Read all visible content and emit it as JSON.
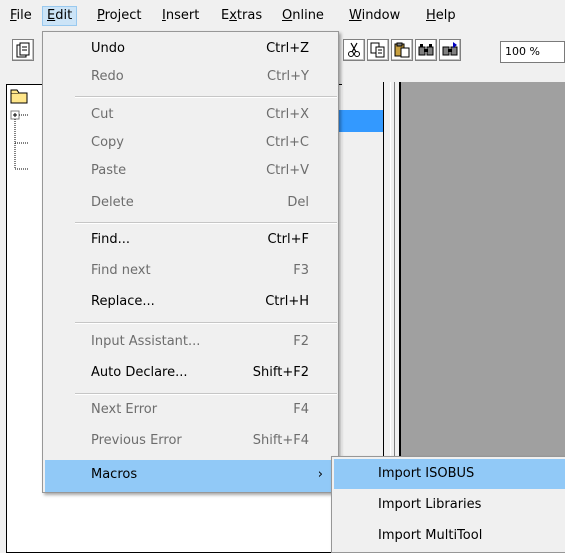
{
  "menubar": {
    "items": [
      {
        "label": "File",
        "access_key": "F",
        "rest": "ile"
      },
      {
        "label": "Edit",
        "access_key": "E",
        "rest": "dit"
      },
      {
        "label": "Project",
        "access_key": "P",
        "rest": "roject"
      },
      {
        "label": "Insert",
        "access_key": "I",
        "rest": "nsert"
      },
      {
        "label": "Extras",
        "pre": "E",
        "access_key": "x",
        "rest": "tras"
      },
      {
        "label": "Online",
        "access_key": "O",
        "rest": "nline"
      },
      {
        "label": "Window",
        "access_key": "W",
        "rest": "indow"
      },
      {
        "label": "Help",
        "access_key": "H",
        "rest": "elp"
      }
    ],
    "active": "Edit"
  },
  "toolbar": {
    "zoom": "100 %",
    "icons": [
      "new-document-icon",
      "cut-icon",
      "copy-icon",
      "paste-icon",
      "find-icon",
      "find-next-icon"
    ]
  },
  "edit_menu": {
    "items": [
      {
        "label": "Undo",
        "shortcut": "Ctrl+Z",
        "enabled": true
      },
      {
        "label": "Redo",
        "shortcut": "Ctrl+Y",
        "enabled": false
      },
      {
        "label": "Cut",
        "shortcut": "Ctrl+X",
        "enabled": false
      },
      {
        "label": "Copy",
        "shortcut": "Ctrl+C",
        "enabled": false
      },
      {
        "label": "Paste",
        "shortcut": "Ctrl+V",
        "enabled": false
      },
      {
        "label": "Delete",
        "shortcut": "Del",
        "enabled": false
      },
      {
        "label": "Find...",
        "shortcut": "Ctrl+F",
        "enabled": true
      },
      {
        "label": "Find next",
        "shortcut": "F3",
        "enabled": false
      },
      {
        "label": "Replace...",
        "shortcut": "Ctrl+H",
        "enabled": true
      },
      {
        "label": "Input Assistant...",
        "shortcut": "F2",
        "enabled": false
      },
      {
        "label": "Auto Declare...",
        "shortcut": "Shift+F2",
        "enabled": true
      },
      {
        "label": "Next Error",
        "shortcut": "F4",
        "enabled": false
      },
      {
        "label": "Previous Error",
        "shortcut": "Shift+F4",
        "enabled": false
      },
      {
        "label": "Macros",
        "submenu_arrow": "›",
        "enabled": true,
        "highlighted": true
      }
    ]
  },
  "macros_submenu": {
    "items": [
      {
        "label": "Import ISOBUS",
        "highlighted": true
      },
      {
        "label": "Import Libraries",
        "highlighted": false
      },
      {
        "label": "Import MultiTool",
        "highlighted": false
      }
    ]
  },
  "colors": {
    "selection": "#3399ff",
    "menu_highlight": "#91c9f7",
    "editor_bg": "#a0a0a0",
    "disabled_text": "#6d6d6d"
  }
}
